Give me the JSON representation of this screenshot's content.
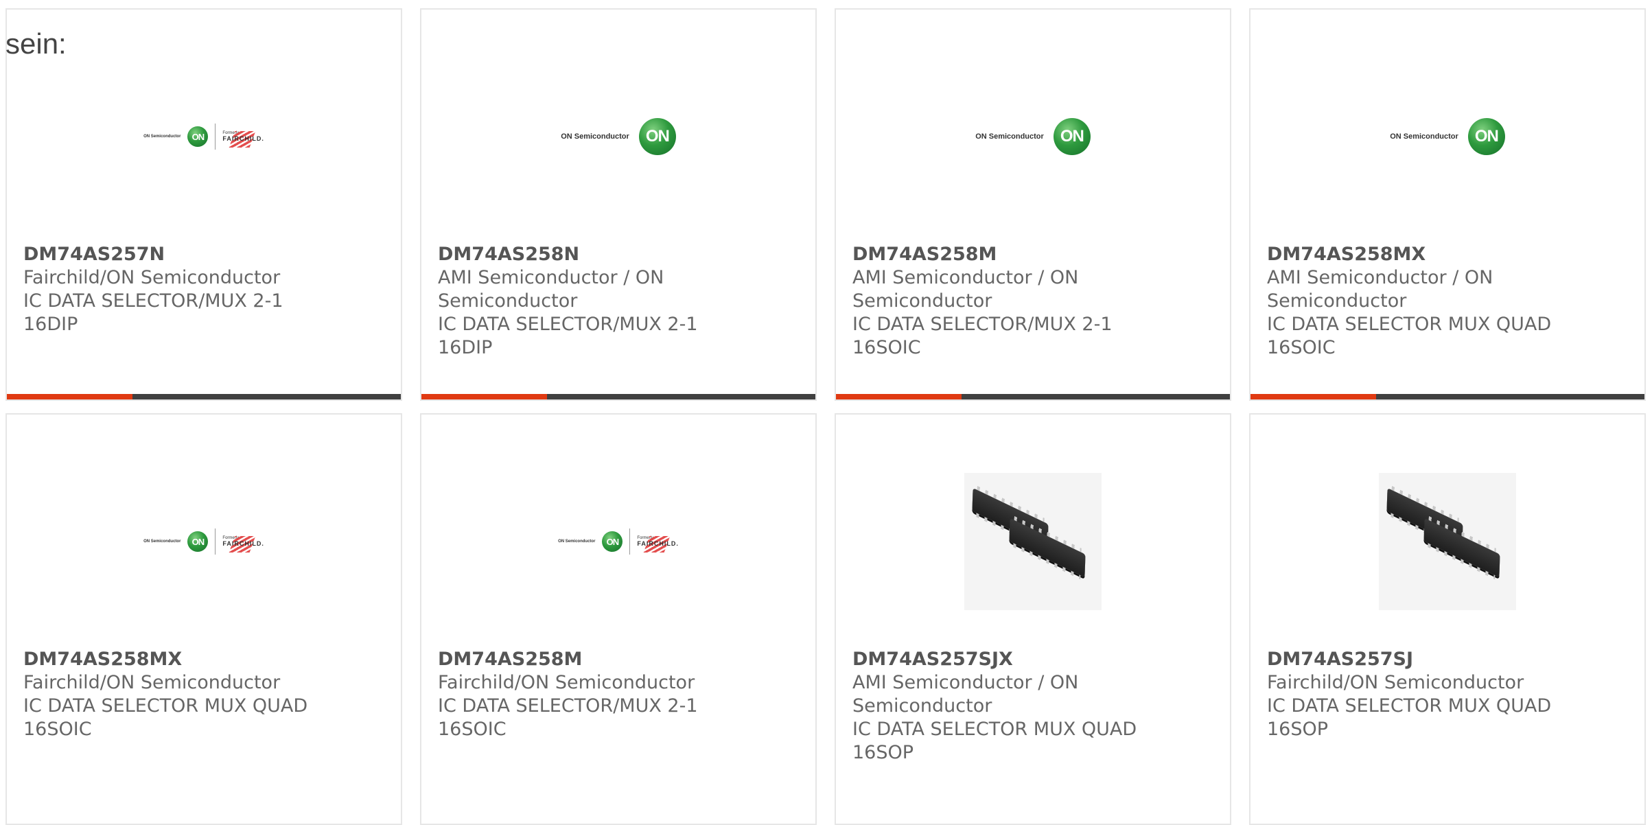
{
  "intro_text": "sein:",
  "products": [
    {
      "part": "DM74AS257N",
      "maker": "Fairchild/ON Semiconductor",
      "desc": "IC DATA SELECTOR/MUX 2-1",
      "pkg": "16DIP",
      "image": "on-fairchild-logo"
    },
    {
      "part": "DM74AS258N",
      "maker": "AMI Semiconductor / ON",
      "maker2": "Semiconductor",
      "desc": "IC DATA SELECTOR/MUX 2-1",
      "pkg": "16DIP",
      "image": "on-semiconductor-logo"
    },
    {
      "part": "DM74AS258M",
      "maker": "AMI Semiconductor / ON",
      "maker2": "Semiconductor",
      "desc": "IC DATA SELECTOR/MUX 2-1",
      "pkg": "16SOIC",
      "image": "on-semiconductor-logo"
    },
    {
      "part": "DM74AS258MX",
      "maker": "AMI Semiconductor / ON",
      "maker2": "Semiconductor",
      "desc": "IC DATA SELECTOR MUX QUAD",
      "pkg": "16SOIC",
      "image": "on-semiconductor-logo"
    },
    {
      "part": "DM74AS258MX",
      "maker": "Fairchild/ON Semiconductor",
      "desc": "IC DATA SELECTOR MUX QUAD",
      "pkg": "16SOIC",
      "image": "on-fairchild-logo"
    },
    {
      "part": "DM74AS258M",
      "maker": "Fairchild/ON Semiconductor",
      "desc": "IC DATA SELECTOR/MUX 2-1",
      "pkg": "16SOIC",
      "image": "on-fairchild-logo"
    },
    {
      "part": "DM74AS257SJX",
      "maker": "AMI Semiconductor / ON",
      "maker2": "Semiconductor",
      "desc": "IC DATA SELECTOR MUX QUAD",
      "pkg": "16SOP",
      "image": "ic-chip-photo"
    },
    {
      "part": "DM74AS257SJ",
      "maker": "Fairchild/ON Semiconductor",
      "desc": "IC DATA SELECTOR MUX QUAD",
      "pkg": "16SOP",
      "image": "ic-chip-photo"
    }
  ],
  "logos": {
    "on_semi_text": "ON Semiconductor",
    "on_mark": "ON",
    "fairchild_formerly": "Formerly",
    "fairchild_name": "FAIRCHILD."
  },
  "colors": {
    "accent": "#e03a12",
    "bar_dark": "#404040",
    "on_green": "#2e9a3e"
  }
}
